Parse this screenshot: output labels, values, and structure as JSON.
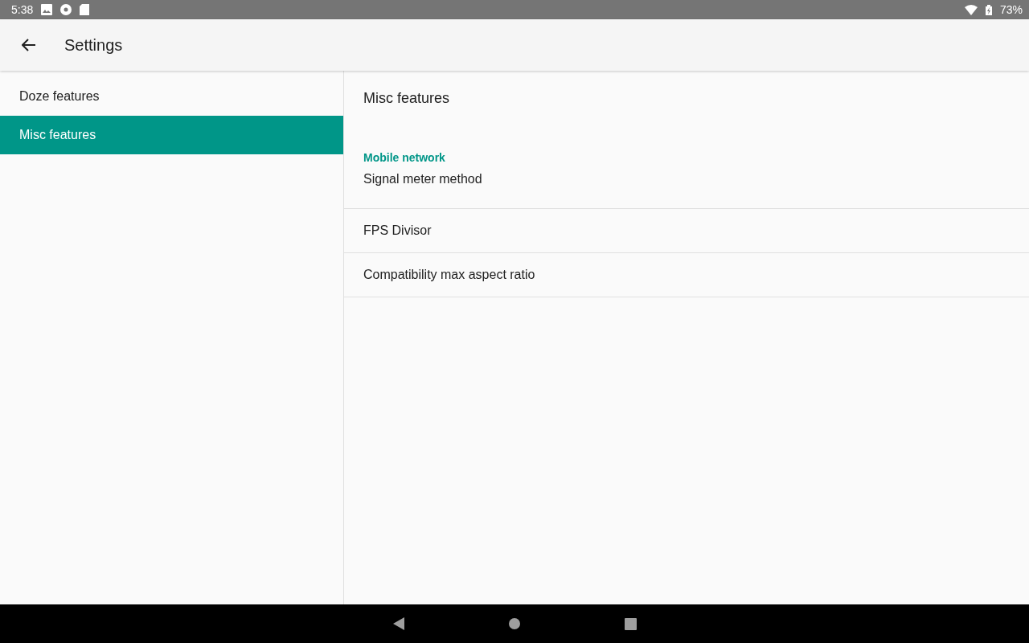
{
  "status_bar": {
    "time": "5:38",
    "battery": "73%"
  },
  "app_bar": {
    "title": "Settings"
  },
  "sidebar": {
    "items": [
      {
        "label": "Doze features",
        "selected": false
      },
      {
        "label": "Misc features",
        "selected": true
      }
    ]
  },
  "detail": {
    "title": "Misc features",
    "category": "Mobile network",
    "items": [
      "Signal meter method",
      "FPS Divisor",
      "Compatibility max aspect ratio"
    ]
  }
}
